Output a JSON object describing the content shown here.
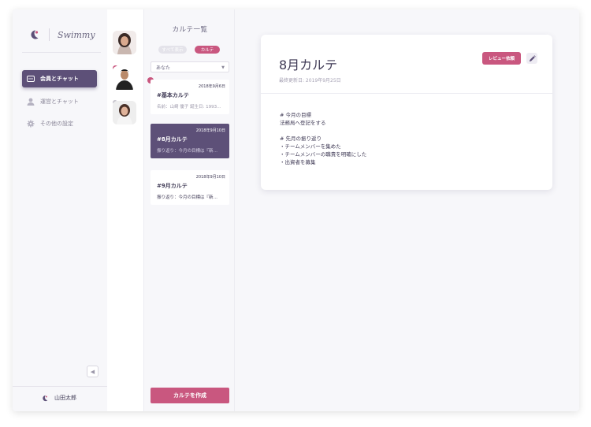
{
  "app": {
    "name": "Swimmy"
  },
  "nav": {
    "items": [
      {
        "label": "会員とチャット",
        "icon": "chat-icon",
        "active": true
      },
      {
        "label": "運営とチャット",
        "icon": "person-icon",
        "active": false
      },
      {
        "label": "その他の設定",
        "icon": "gear-icon",
        "active": false
      }
    ],
    "user_name": "山田太郎"
  },
  "list": {
    "title": "カルテ一覧",
    "toggle_off": "すべて表示",
    "toggle_on": "カルテ",
    "filter_selected": "あなた",
    "cards": [
      {
        "date": "2018年9月6日",
        "title": "#基本カルテ",
        "subtitle": "名前：山崎 優子 誕生日: 1993…"
      },
      {
        "date": "2018年9月10日",
        "title": "#8月カルテ",
        "subtitle": "振り返り：今月の目標は『新…"
      },
      {
        "date": "2018年9月10日",
        "title": "#9月カルテ",
        "subtitle": "振り返り：今月の目標は『新…"
      }
    ],
    "create_label": "カルテを作成"
  },
  "detail": {
    "title": "8月カルテ",
    "updated": "最終更新日: 2019年9月25日",
    "review_label": "レビュー依頼",
    "body": [
      "# 今月の目標",
      "法務局へ登記をする",
      "",
      "# 先月の振り返り",
      "・チームメンバーを集めた",
      "・チームメンバーの職責を明確にした",
      "・出資者を募集"
    ]
  },
  "colors": {
    "accent": "#c9577f",
    "primary": "#5d5078"
  }
}
